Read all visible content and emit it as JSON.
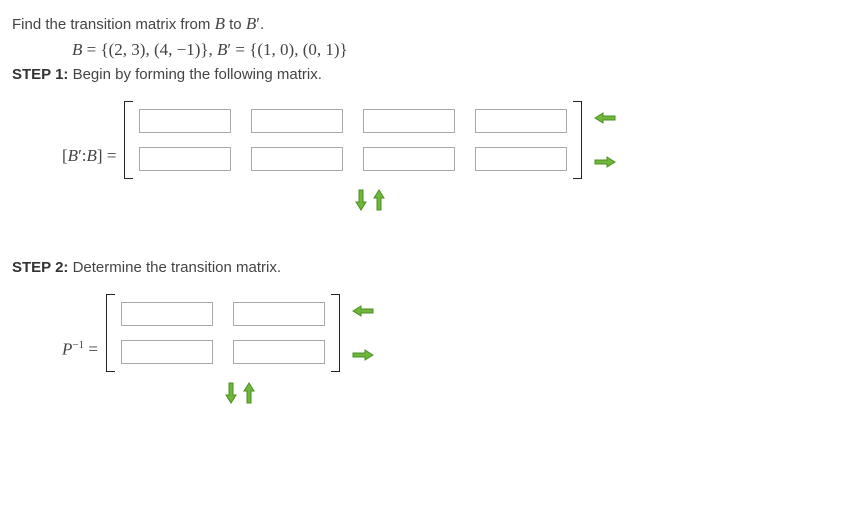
{
  "prompt": {
    "line1_pre": "Find the transition matrix from ",
    "line1_B": "B",
    "line1_mid": " to ",
    "line1_Bprime": "B",
    "line1_prime": "′",
    "line1_post": ".",
    "basis_line": "B = {(2, 3), (4, −1)}, B′ = {(1, 0), (0, 1)}"
  },
  "step1": {
    "label": "STEP 1:",
    "text": " Begin by forming the following matrix.",
    "lhs": "[B′:B] ="
  },
  "step2": {
    "label": "STEP 2:",
    "text": " Determine the transition matrix.",
    "lhs_base": "P",
    "lhs_exp": "−1",
    "lhs_eq": " ="
  },
  "icons": {
    "remove_col": "remove-column",
    "add_col": "add-column",
    "remove_row": "remove-row",
    "add_row": "add-row"
  }
}
